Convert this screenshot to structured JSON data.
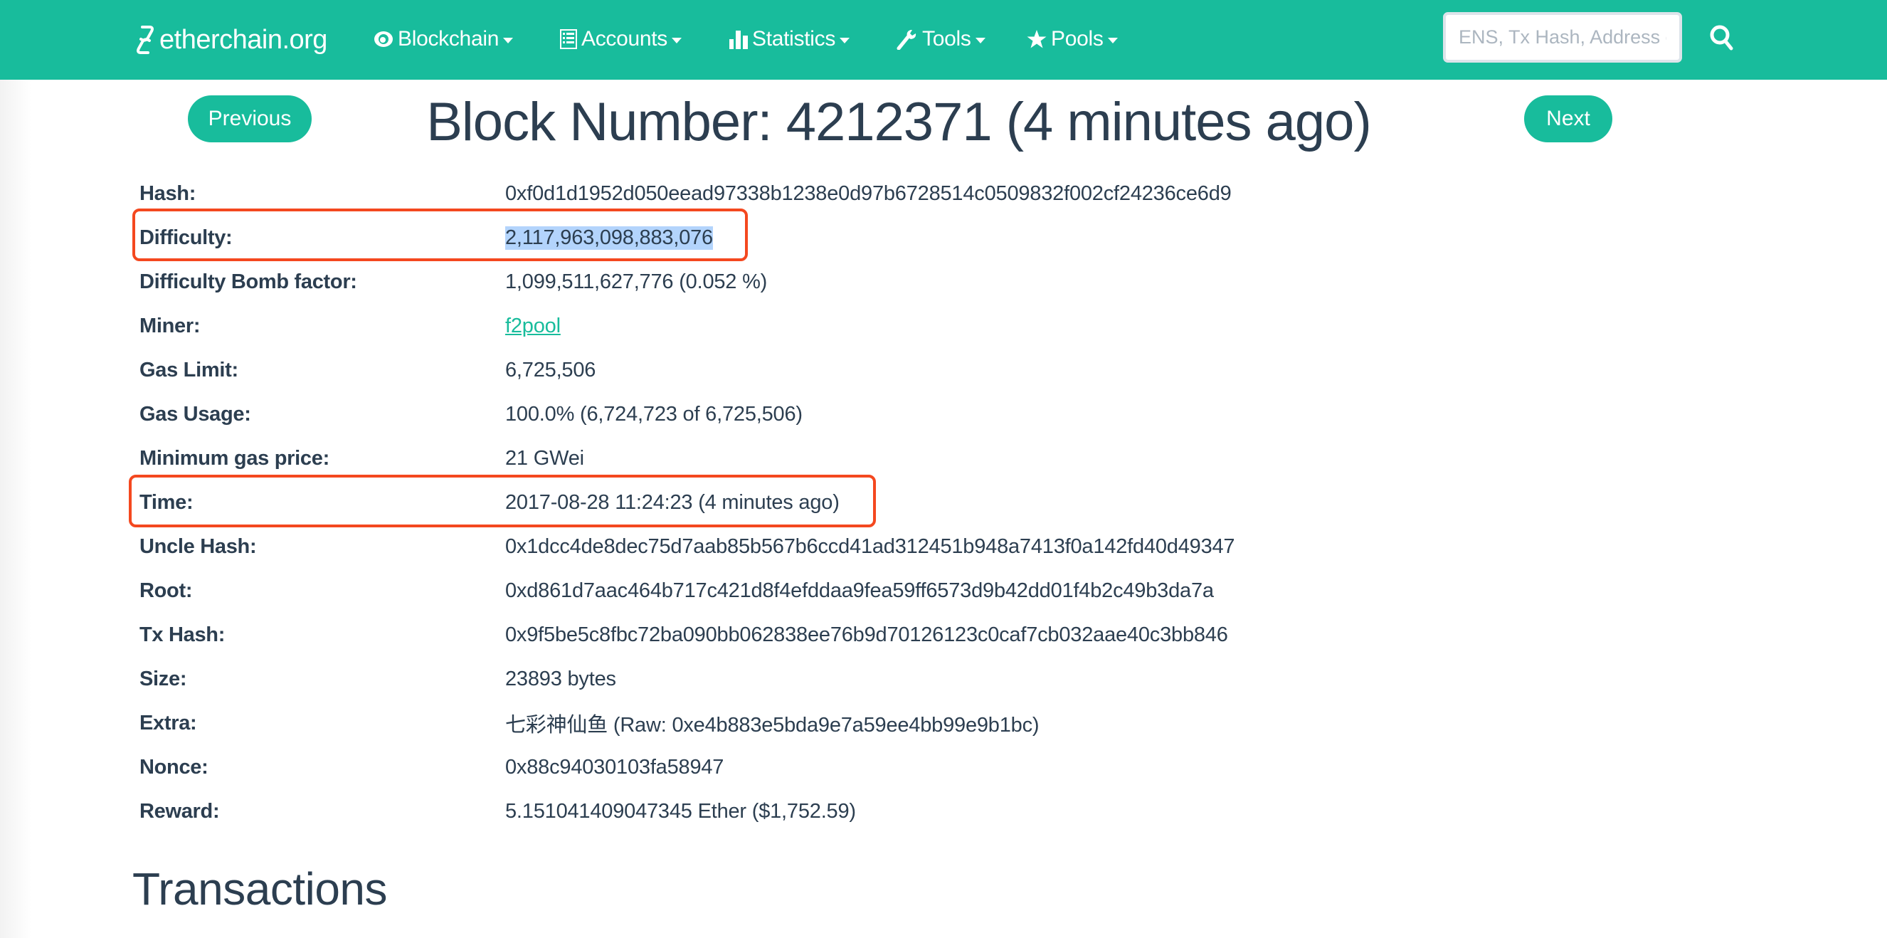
{
  "navbar": {
    "brand": "etherchain.org",
    "brand_color": "#18bc9c",
    "items": [
      {
        "label": "Blockchain",
        "icon": "eye-icon"
      },
      {
        "label": "Accounts",
        "icon": "list-icon"
      },
      {
        "label": "Statistics",
        "icon": "bar-chart-icon"
      },
      {
        "label": "Tools",
        "icon": "wrench-icon"
      },
      {
        "label": "Pools",
        "icon": "star-icon"
      }
    ],
    "search": {
      "placeholder": "ENS, Tx Hash, Address or Block",
      "value": "",
      "icon": "search-icon"
    }
  },
  "pager": {
    "previous_label": "Previous",
    "next_label": "Next"
  },
  "page": {
    "title": "Block Number: 4212371 (4 minutes ago)"
  },
  "details": [
    {
      "label": "Hash:",
      "value": "0xf0d1d1952d050eead97338b1238e0d97b6728514c0509832f002cf24236ce6d9"
    },
    {
      "label": "Difficulty:",
      "value": "2,117,963,098,883,076",
      "selected": true,
      "highlighted": true
    },
    {
      "label": "Difficulty Bomb factor:",
      "value": "1,099,511,627,776 (0.052 %)"
    },
    {
      "label": "Miner:",
      "value": "f2pool",
      "link": true
    },
    {
      "label": "Gas Limit:",
      "value": "6,725,506"
    },
    {
      "label": "Gas Usage:",
      "value": "100.0% (6,724,723 of 6,725,506)"
    },
    {
      "label": "Minimum gas price:",
      "value": "21 GWei"
    },
    {
      "label": "Time:",
      "value": "2017-08-28 11:24:23 (4 minutes ago)",
      "highlighted": true
    },
    {
      "label": "Uncle Hash:",
      "value": "0x1dcc4de8dec75d7aab85b567b6ccd41ad312451b948a7413f0a142fd40d49347"
    },
    {
      "label": "Root:",
      "value": "0xd861d7aac464b717c421d8f4efddaa9fea59ff6573d9b42dd01f4b2c49b3da7a"
    },
    {
      "label": "Tx Hash:",
      "value": "0x9f5be5c8fbc72ba090bb062838ee76b9d70126123c0caf7cb032aae40c3bb846"
    },
    {
      "label": "Size:",
      "value": "23893 bytes"
    },
    {
      "label": "Extra:",
      "value": "七彩神仙鱼 (Raw: 0xe4b883e5bda9e7a59ee4bb99e9b1bc)"
    },
    {
      "label": "Nonce:",
      "value": "0x88c94030103fa58947"
    },
    {
      "label": "Reward:",
      "value": "5.151041409047345 Ether ($1,752.59)"
    }
  ],
  "annotation_color": "#f4481f",
  "sections": {
    "transactions_heading": "Transactions"
  }
}
